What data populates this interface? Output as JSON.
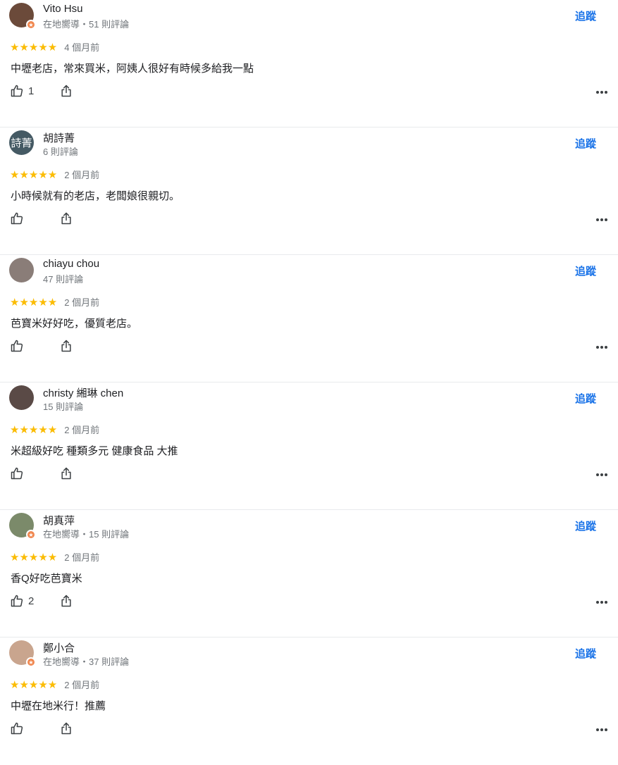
{
  "follow_label": "追蹤",
  "colors": {
    "accent": "#1a73e8",
    "star": "#fbbc04",
    "guide_badge": "#f0874f"
  },
  "icons": {
    "like": "thumb-up-icon",
    "share": "share-icon",
    "more": "more-horizontal-icon"
  },
  "reviews": [
    {
      "name": "Vito Hsu",
      "meta": "在地嚮導・51 則評論",
      "local_guide": true,
      "avatar_text": "",
      "avatar_color": "#6b4a3a",
      "stars": "★★★★★",
      "rating": 5,
      "time": "4 個月前",
      "text": "中壢老店，常來買米，阿姨人很好有時候多給我一點",
      "likes": "1"
    },
    {
      "name": "胡詩菁",
      "meta": "6 則評論",
      "local_guide": false,
      "avatar_text": "詩菁",
      "avatar_color": "#455a64",
      "stars": "★★★★★",
      "rating": 5,
      "time": "2 個月前",
      "text": "小時候就有的老店，老闆娘很親切。",
      "likes": ""
    },
    {
      "name": "chiayu chou",
      "meta": "47 則評論",
      "local_guide": false,
      "avatar_text": "",
      "avatar_color": "#8a7d78",
      "stars": "★★★★★",
      "rating": 5,
      "time": "2 個月前",
      "text": "芭寶米好好吃，優質老店。",
      "likes": ""
    },
    {
      "name": "christy 緗琳 chen",
      "meta": "15 則評論",
      "local_guide": false,
      "avatar_text": "",
      "avatar_color": "#5a4a46",
      "stars": "★★★★★",
      "rating": 5,
      "time": "2 個月前",
      "text": "米超級好吃  種類多元 健康食品 大推",
      "likes": ""
    },
    {
      "name": "胡真萍",
      "meta": "在地嚮導・15 則評論",
      "local_guide": true,
      "avatar_text": "",
      "avatar_color": "#7b8a6a",
      "stars": "★★★★★",
      "rating": 5,
      "time": "2 個月前",
      "text": "香Q好吃芭寶米",
      "likes": "2"
    },
    {
      "name": "鄭小合",
      "meta": "在地嚮導・37 則評論",
      "local_guide": true,
      "avatar_text": "",
      "avatar_color": "#c9a58e",
      "stars": "★★★★★",
      "rating": 5,
      "time": "2 個月前",
      "text": "中壢在地米行！推薦",
      "likes": ""
    }
  ]
}
